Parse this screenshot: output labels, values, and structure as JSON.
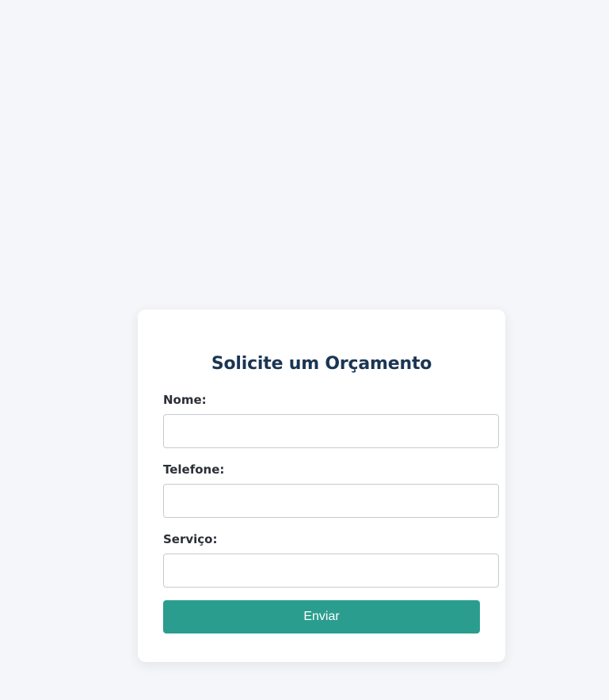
{
  "form": {
    "title": "Solicite um Orçamento",
    "fields": [
      {
        "label": "Nome:",
        "value": "",
        "placeholder": ""
      },
      {
        "label": "Telefone:",
        "value": "",
        "placeholder": ""
      },
      {
        "label": "Serviço:",
        "value": "",
        "placeholder": ""
      }
    ],
    "submit_label": "Enviar"
  },
  "colors": {
    "page_background": "#f5f6f9",
    "card_background": "#ffffff",
    "title": "#1b3553",
    "label": "#2b2f36",
    "input_border": "#c6c9cf",
    "button_background": "#2a9d8f",
    "button_text": "#ffffff"
  }
}
